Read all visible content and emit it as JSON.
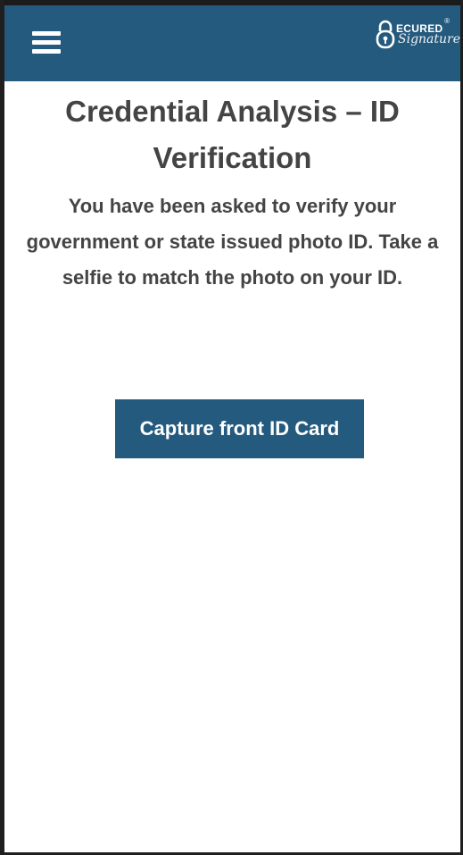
{
  "header": {
    "menu_icon": "hamburger-menu-icon",
    "logo": {
      "line1": "ECURED",
      "line2": "Signature",
      "reg_mark": "®",
      "brand_color": "#245a7e"
    }
  },
  "main": {
    "title": "Credential Analysis – ID Verification",
    "description": "You have been asked to verify your government or state issued photo ID. Take a selfie to match the photo on your ID.",
    "capture_button_label": "Capture front ID Card"
  }
}
